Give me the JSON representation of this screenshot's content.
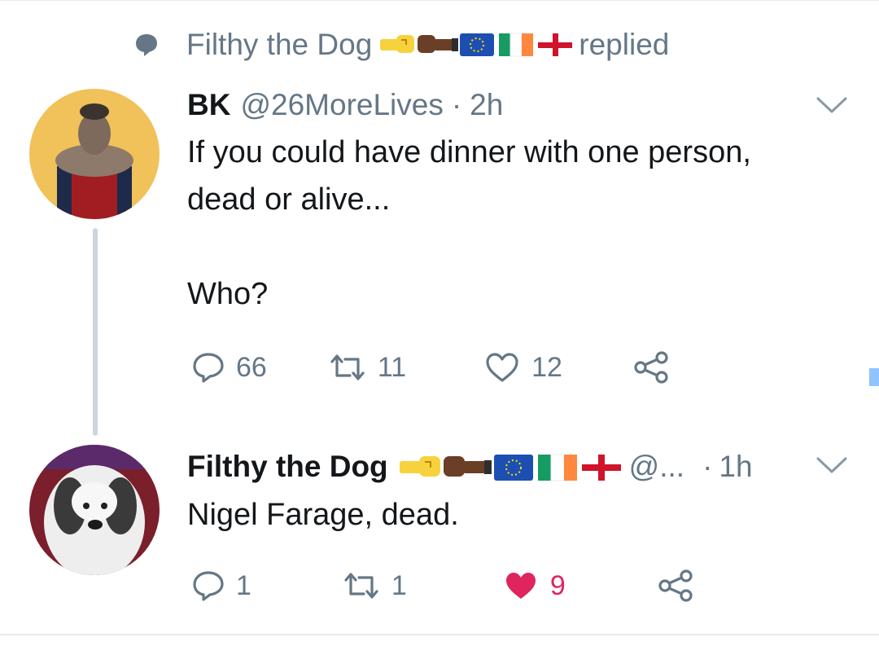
{
  "reply_context": {
    "name": "Filthy the Dog",
    "suffix": "replied",
    "name_emoji": [
      "raised-fist-yellow-icon",
      "raised-fist-brown-icon",
      "eu-flag-icon",
      "ireland-flag-icon",
      "england-flag-icon"
    ]
  },
  "tweet1": {
    "display_name": "BK",
    "handle": "@26MoreLives",
    "separator": "·",
    "time": "2h",
    "line1": "If you could have dinner with one person,",
    "line2": "dead or alive...",
    "line3": "Who?",
    "actions": {
      "replies": "66",
      "retweets": "11",
      "likes": "12"
    }
  },
  "tweet2": {
    "display_name": "Filthy the Dog",
    "handle": "@...",
    "separator": "·",
    "time": "1h",
    "text": "Nigel Farage, dead.",
    "actions": {
      "replies": "1",
      "retweets": "1",
      "likes": "9"
    },
    "liked": true
  },
  "colors": {
    "muted": "#657786",
    "like": "#e0245e",
    "thread_line": "#ccd6dd"
  }
}
